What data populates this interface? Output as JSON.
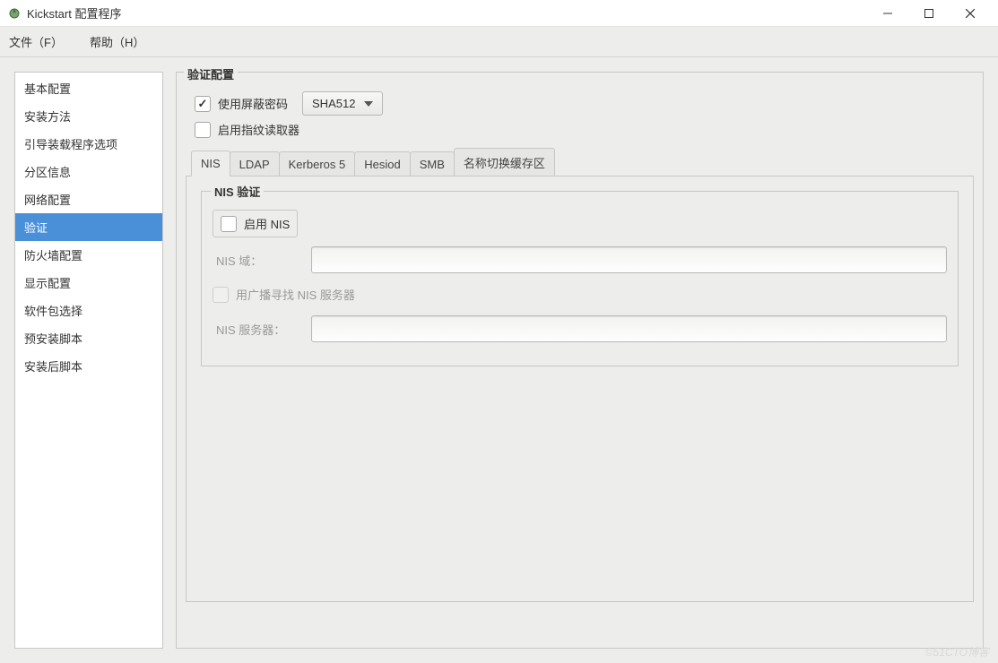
{
  "window": {
    "title": "Kickstart 配置程序"
  },
  "menu": {
    "file": "文件（F）",
    "help": "帮助（H）"
  },
  "sidebar": {
    "items": [
      "基本配置",
      "安装方法",
      "引导装载程序选项",
      "分区信息",
      "网络配置",
      "验证",
      "防火墙配置",
      "显示配置",
      "软件包选择",
      "预安装脚本",
      "安装后脚本"
    ],
    "selected_index": 5
  },
  "panel": {
    "title": "验证配置",
    "shadow_pw_label": "使用屏蔽密码",
    "hash_value": "SHA512",
    "fingerprint_label": "启用指纹读取器"
  },
  "tabs": {
    "items": [
      "NIS",
      "LDAP",
      "Kerberos 5",
      "Hesiod",
      "SMB",
      "名称切换缓存区"
    ],
    "active_index": 0
  },
  "nis": {
    "legend": "NIS 验证",
    "enable_label": "启用 NIS",
    "domain_label": "NIS 域：",
    "broadcast_label": "用广播寻找 NIS 服务器",
    "server_label": "NIS 服务器："
  },
  "watermark": "©51CTO博客"
}
